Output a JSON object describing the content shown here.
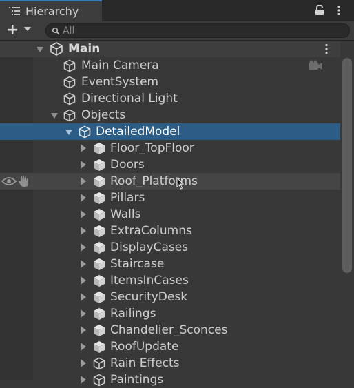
{
  "window": {
    "tab_label": "Hierarchy"
  },
  "toolbar": {
    "add_label": "+",
    "search_placeholder": "All"
  },
  "scene": {
    "name": "Main"
  },
  "items": [
    {
      "label": "Main Camera",
      "icon": "gameobject-outline-icon"
    },
    {
      "label": "EventSystem",
      "icon": "gameobject-outline-icon"
    },
    {
      "label": "Directional Light",
      "icon": "gameobject-outline-icon"
    },
    {
      "label": "Objects",
      "icon": "gameobject-outline-icon",
      "expanded": true
    },
    {
      "label": "DetailedModel",
      "icon": "gameobject-outline-icon",
      "expanded": true,
      "selected": true
    },
    {
      "label": "Floor_TopFloor",
      "icon": "prefab-icon"
    },
    {
      "label": "Doors",
      "icon": "prefab-icon"
    },
    {
      "label": "Roof_Platforms",
      "icon": "prefab-icon",
      "hovered": true
    },
    {
      "label": "Pillars",
      "icon": "prefab-icon"
    },
    {
      "label": "Walls",
      "icon": "prefab-icon"
    },
    {
      "label": "ExtraColumns",
      "icon": "prefab-icon"
    },
    {
      "label": "DisplayCases",
      "icon": "prefab-icon"
    },
    {
      "label": "Staircase",
      "icon": "prefab-icon"
    },
    {
      "label": "ItemsInCases",
      "icon": "prefab-icon"
    },
    {
      "label": "SecurityDesk",
      "icon": "prefab-icon"
    },
    {
      "label": "Railings",
      "icon": "prefab-icon"
    },
    {
      "label": "Chandelier_Sconces",
      "icon": "prefab-icon"
    },
    {
      "label": "RoofUpdate",
      "icon": "prefab-icon"
    },
    {
      "label": "Rain Effects",
      "icon": "gameobject-outline-icon"
    },
    {
      "label": "Paintings",
      "icon": "gameobject-outline-icon"
    }
  ],
  "colors": {
    "selection": "#2c5d87",
    "tab_accent": "#3a79bb",
    "background": "#383838"
  }
}
